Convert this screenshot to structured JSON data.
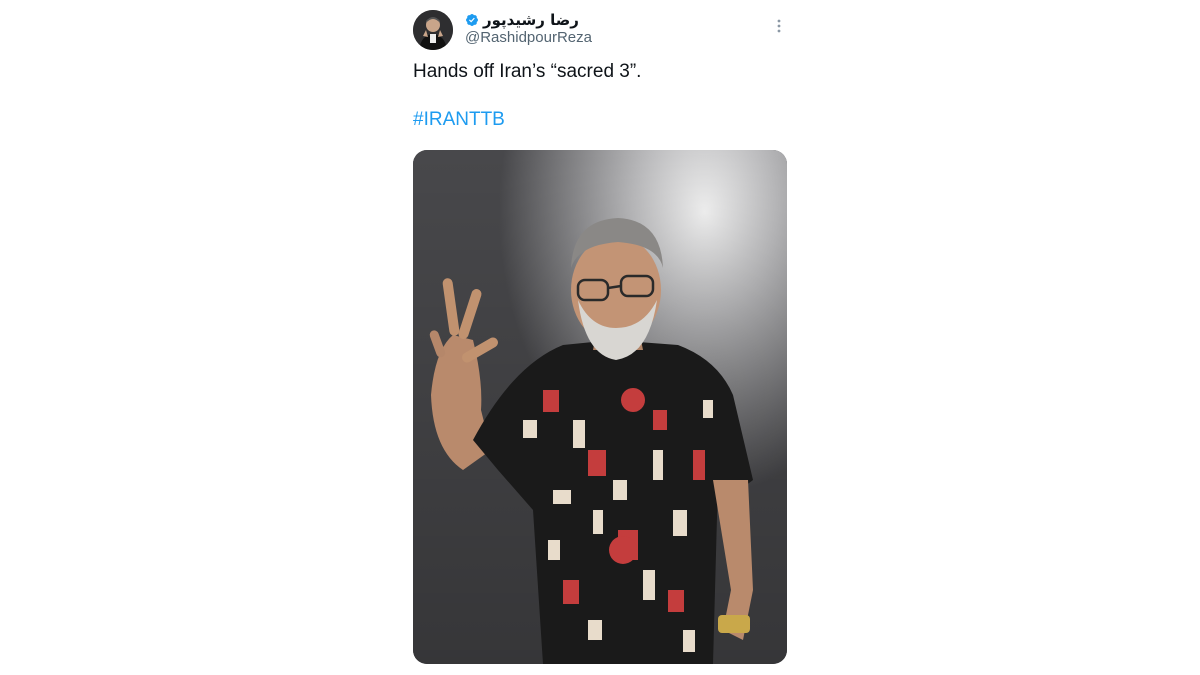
{
  "tweet": {
    "author": {
      "display_name": "رضا رشیدپور",
      "handle": "@RashidpourReza",
      "verified": true,
      "avatar_icon": "profile-photo"
    },
    "more_icon": "more-options-icon",
    "text": "Hands off Iran’s “sacred 3”.",
    "hashtag": "#IRANTTB",
    "media": {
      "type": "photo",
      "alt_icon": "person-three-finger-gesture-photo"
    }
  },
  "colors": {
    "text_primary": "#0f1419",
    "text_secondary": "#536471",
    "link": "#1d9bf0",
    "verified": "#1d9bf0"
  }
}
